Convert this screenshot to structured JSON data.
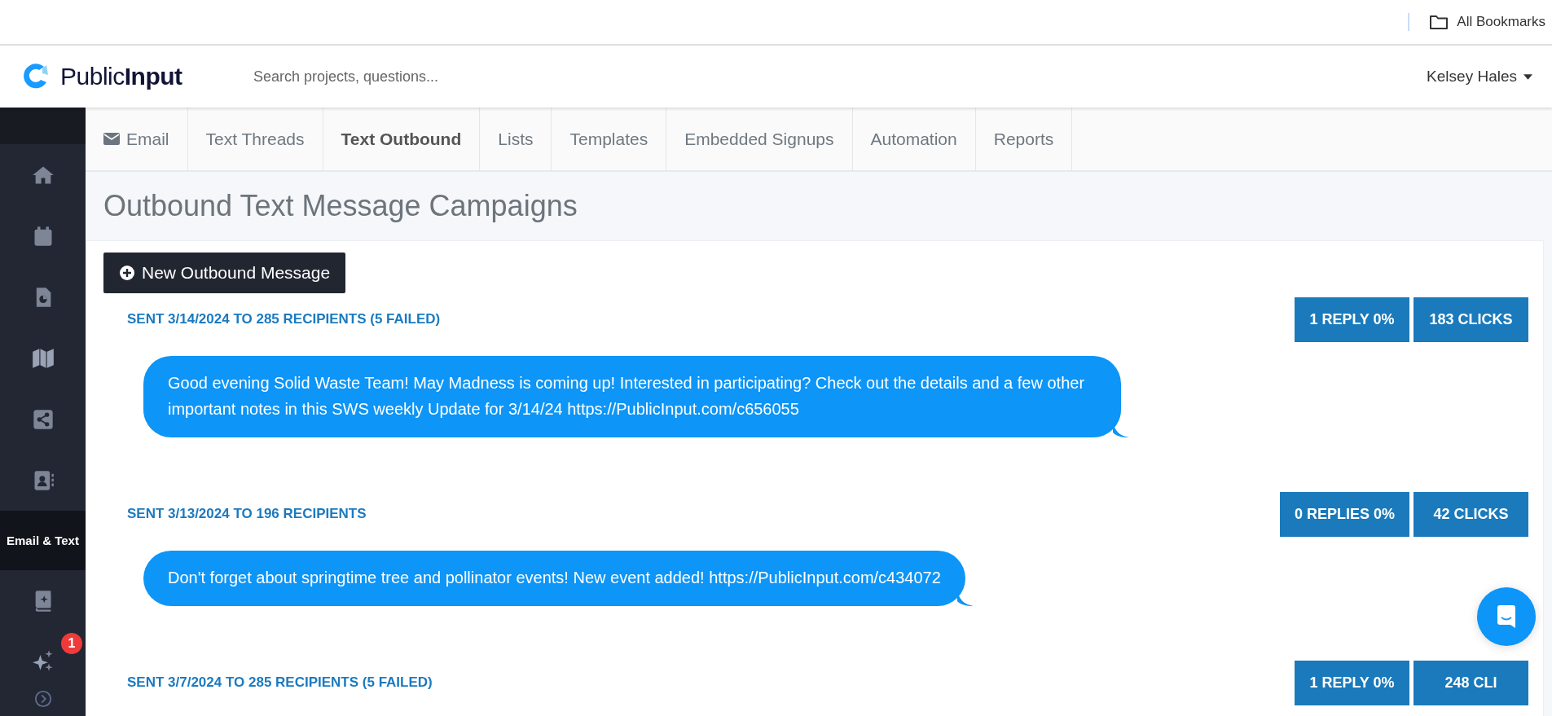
{
  "bookmarks_bar": {
    "label": "All Bookmarks"
  },
  "header": {
    "logo": {
      "light": "Public",
      "bold": "Input"
    },
    "search": {
      "placeholder": "Search projects, questions..."
    },
    "user": "Kelsey Hales"
  },
  "sidebar": {
    "active_section": {
      "label": "Email & Text",
      "selected": true
    },
    "notification_badge": "1"
  },
  "tabs": [
    {
      "label": "Email",
      "kind": "with-icon",
      "selected": false
    },
    {
      "label": "Text Threads",
      "kind": "plain",
      "selected": false
    },
    {
      "label": "Text Outbound",
      "kind": "plain",
      "selected": true
    },
    {
      "label": "Lists",
      "kind": "plain",
      "selected": false
    },
    {
      "label": "Templates",
      "kind": "plain",
      "selected": false
    },
    {
      "label": "Embedded Signups",
      "kind": "plain",
      "selected": false
    },
    {
      "label": "Automation",
      "kind": "plain",
      "selected": false
    },
    {
      "label": "Reports",
      "kind": "plain",
      "selected": false
    }
  ],
  "page_title": "Outbound Text Message Campaigns",
  "new_button": "New Outbound Message",
  "campaigns": [
    {
      "heading": "SENT 3/14/2024 TO 285 RECIPIENTS (5 FAILED)",
      "replies": "1 REPLY 0%",
      "clicks": "183 CLICKS",
      "message": "Good evening Solid Waste Team! May Madness is coming up! Interested in participating? Check out the details and a few other important notes in this SWS weekly Update for 3/14/24 https://PublicInput.com/c656055"
    },
    {
      "heading": "SENT 3/13/2024 TO 196 RECIPIENTS",
      "replies": "0 REPLIES 0%",
      "clicks": "42 CLICKS",
      "message": "Don't forget about springtime tree and pollinator events! New event added! https://PublicInput.com/c434072"
    },
    {
      "heading": "SENT 3/7/2024 TO 285 RECIPIENTS (5 FAILED)",
      "replies": "1 REPLY 0%",
      "clicks": "248 CLI"
    }
  ]
}
